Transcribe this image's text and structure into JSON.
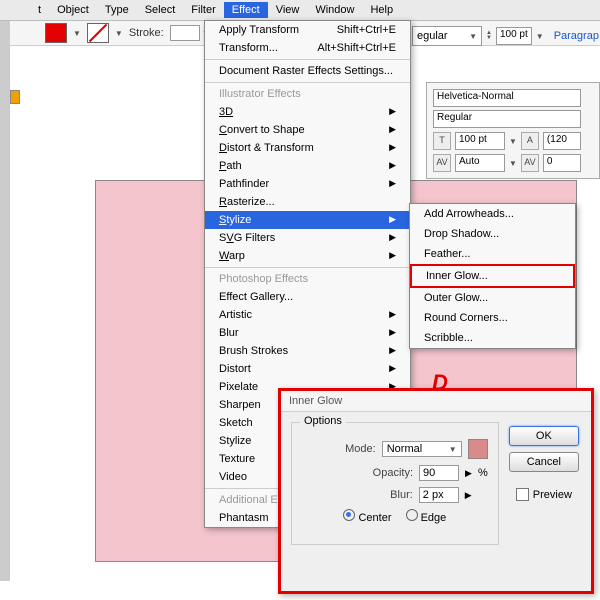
{
  "menubar": {
    "items": [
      "t",
      "Object",
      "Type",
      "Select",
      "Filter",
      "Effect",
      "View",
      "Window",
      "Help"
    ],
    "open_index": 5
  },
  "toolbar": {
    "stroke_label": "Stroke:",
    "stroke_val": "",
    "regular": "egular",
    "pt_val": "100 pt",
    "paragraph": "Paragrap"
  },
  "fontpanel": {
    "font": "Helvetica-Normal",
    "style": "Regular",
    "size": "100 pt",
    "lead_auto": "Auto",
    "lead_val": "(120",
    "track": "0"
  },
  "effect_menu": {
    "apply": "Apply Transform",
    "apply_sc": "Shift+Ctrl+E",
    "transform": "Transform...",
    "transform_sc": "Alt+Shift+Ctrl+E",
    "docraster": "Document Raster Effects Settings...",
    "illus_head": "Illustrator Effects",
    "illus": [
      "3D",
      "Convert to Shape",
      "Distort & Transform",
      "Path",
      "Pathfinder",
      "Rasterize...",
      "Stylize",
      "SVG Filters",
      "Warp"
    ],
    "ps_head": "Photoshop Effects",
    "ps": [
      "Effect Gallery...",
      "Artistic",
      "Blur",
      "Brush Strokes",
      "Distort",
      "Pixelate",
      "Sharpen",
      "Sketch",
      "Stylize",
      "Texture",
      "Video"
    ],
    "add_head": "Additional E",
    "add": [
      "Phantasm"
    ]
  },
  "stylize_sub": [
    "Add Arrowheads...",
    "Drop Shadow...",
    "Feather...",
    "Inner Glow...",
    "Outer Glow...",
    "Round Corners...",
    "Scribble..."
  ],
  "dialog": {
    "title": "Inner Glow",
    "options": "Options",
    "mode_l": "Mode:",
    "mode_v": "Normal",
    "opacity_l": "Opacity:",
    "opacity_v": "90",
    "pct": "%",
    "blur_l": "Blur:",
    "blur_v": "2 px",
    "center": "Center",
    "edge": "Edge",
    "ok": "OK",
    "cancel": "Cancel",
    "preview": "Preview"
  }
}
